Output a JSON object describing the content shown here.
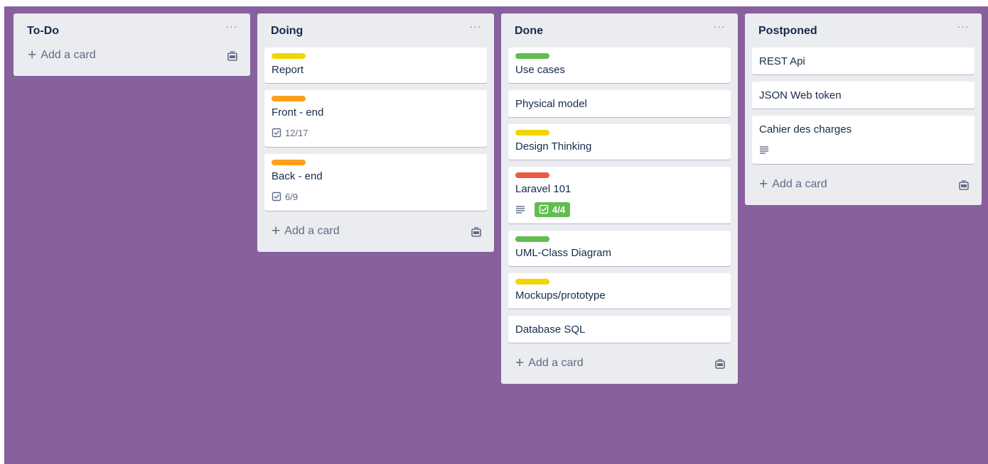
{
  "board": {
    "lists": [
      {
        "title": "To-Do",
        "menu": "···",
        "cards": [],
        "add_card": "Add a card"
      },
      {
        "title": "Doing",
        "menu": "···",
        "cards": [
          {
            "title": "Report",
            "label_color": "#f2d600"
          },
          {
            "title": "Front - end",
            "label_color": "#ff9f1a",
            "checklist": "12/17"
          },
          {
            "title": "Back - end",
            "label_color": "#ff9f1a",
            "checklist": "6/9"
          }
        ],
        "add_card": "Add a card"
      },
      {
        "title": "Done",
        "menu": "···",
        "cards": [
          {
            "title": "Use cases",
            "label_color": "#61bd4f"
          },
          {
            "title": "Physical model"
          },
          {
            "title": "Design Thinking",
            "label_color": "#f2d600"
          },
          {
            "title": "Laravel 101",
            "label_color": "#eb5a46",
            "description_icon": "description-icon",
            "checklist": "4/4",
            "checklist_complete": true
          },
          {
            "title": "UML-Class Diagram",
            "label_color": "#61bd4f"
          },
          {
            "title": "Mockups/prototype",
            "label_color": "#f2d600"
          },
          {
            "title": "Database SQL"
          }
        ],
        "add_card": "Add a card"
      },
      {
        "title": "Postponed",
        "menu": "···",
        "cards": [
          {
            "title": "REST Api"
          },
          {
            "title": "JSON Web token"
          },
          {
            "title": "Cahier des charges",
            "description_icon": "description-icon"
          }
        ],
        "add_card": "Add a card"
      }
    ]
  },
  "colors": {
    "board_background": "#89609e",
    "list_background": "#ebecf0",
    "label_yellow": "#f2d600",
    "label_orange": "#ff9f1a",
    "label_green": "#61bd4f",
    "label_red": "#eb5a46"
  },
  "icons": {
    "plus": "+",
    "checklist": "checklist-icon",
    "description": "description-icon",
    "template": "card-template-icon"
  }
}
